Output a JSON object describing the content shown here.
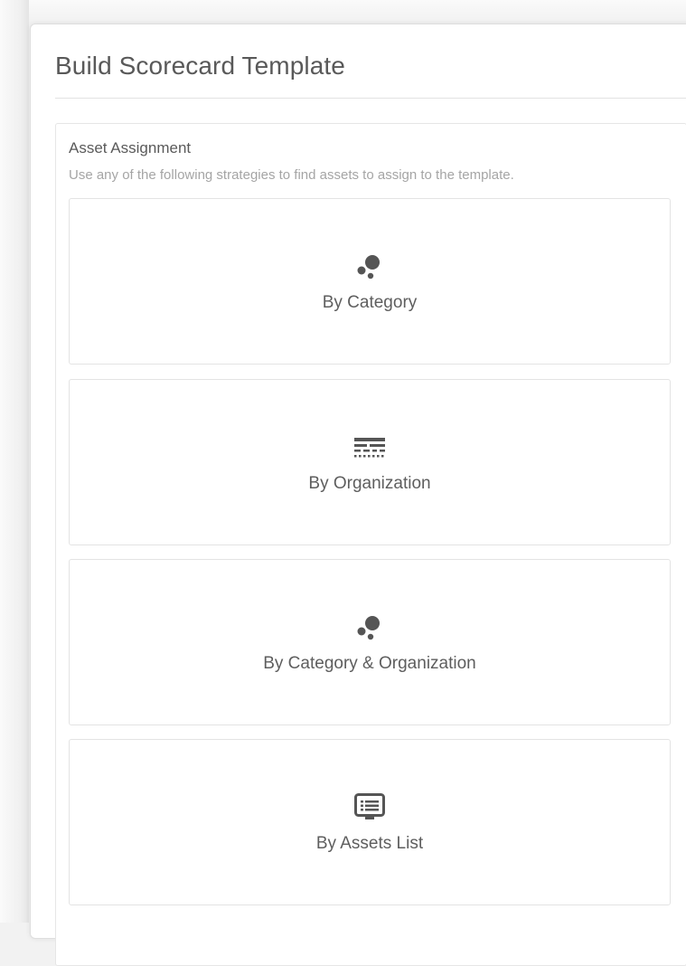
{
  "panel": {
    "title": "Build Scorecard Template"
  },
  "asset_assignment": {
    "title": "Asset Assignment",
    "subtitle": "Use any of the following strategies to find assets to assign to the template.",
    "options": [
      {
        "label": "By Category",
        "icon": "bubbles-icon"
      },
      {
        "label": "By Organization",
        "icon": "org-structure-icon"
      },
      {
        "label": "By Category & Organization",
        "icon": "bubbles-icon"
      },
      {
        "label": "By Assets List",
        "icon": "list-monitor-icon"
      }
    ]
  },
  "colors": {
    "icon": "#555555",
    "text": "#5e5e5e",
    "muted": "#a5a5a5",
    "border": "#e3e3e3"
  }
}
